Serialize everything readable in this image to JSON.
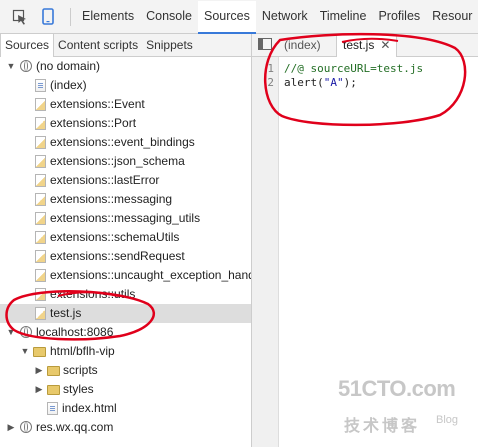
{
  "toolbar": {
    "tabs": [
      "Elements",
      "Console",
      "Sources",
      "Network",
      "Timeline",
      "Profiles",
      "Resour"
    ],
    "active_tab": "Sources"
  },
  "navigator": {
    "tabs": [
      "Sources",
      "Content scripts",
      "Snippets"
    ],
    "tree": {
      "root_label": "(no domain)",
      "files": [
        "(index)",
        "extensions::Event",
        "extensions::Port",
        "extensions::event_bindings",
        "extensions::json_schema",
        "extensions::lastError",
        "extensions::messaging",
        "extensions::messaging_utils",
        "extensions::schemaUtils",
        "extensions::sendRequest",
        "extensions::uncaught_exception_handl",
        "extensions::utils",
        "test.js"
      ],
      "host1": "localhost:8086",
      "folder": "html/bflh-vip",
      "subfolders": [
        "scripts",
        "styles"
      ],
      "page": "index.html",
      "host2": "res.wx.qq.com"
    }
  },
  "editor": {
    "tabs": [
      "(index)",
      "test.js"
    ],
    "line_numbers": [
      "1",
      "2"
    ],
    "line1_comment": "//@ sourceURL=test.js",
    "line2_fn": "alert(",
    "line2_str": "\"A\"",
    "line2_end": ");"
  },
  "watermark": {
    "site": "51CTO.com",
    "sub": "技术博客",
    "blog": "Blog"
  },
  "colors": {
    "accent": "#3879d9",
    "annotation": "#e0001b",
    "watermark": "#c7c7c7"
  }
}
